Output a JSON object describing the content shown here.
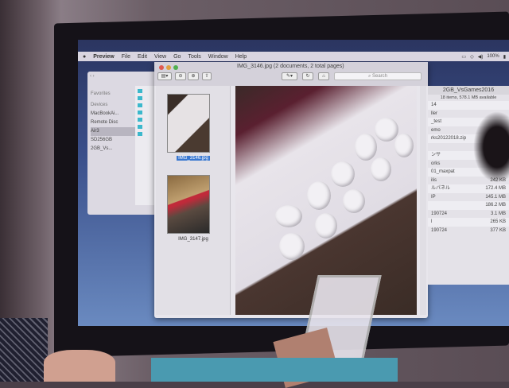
{
  "menubar": {
    "app": "Preview",
    "items": [
      "File",
      "Edit",
      "View",
      "Go",
      "Tools",
      "Window",
      "Help"
    ],
    "battery": "100%"
  },
  "finder_left": {
    "favorites": "Favorites",
    "devices": "Devices",
    "items": [
      "MacBookAi...",
      "Remote Disc",
      "Air3",
      "SD256GB",
      "2GB_Vs..."
    ]
  },
  "preview": {
    "title": "IMG_3146.jpg (2 documents, 2 total pages)",
    "search_placeholder": "Search",
    "thumbnails": [
      {
        "label": "IMG_3146.jpg",
        "selected": true
      },
      {
        "label": "IMG_3147.jpg",
        "selected": false
      }
    ]
  },
  "finder_right": {
    "title": "2GB_VsGames2016",
    "status": "18 items, 578.1 MB available",
    "rows": [
      {
        "name": "14",
        "size": ""
      },
      {
        "name": "ller",
        "size": ""
      },
      {
        "name": "_test",
        "size": ""
      },
      {
        "name": "emo",
        "size": ""
      },
      {
        "name": "rks20122018.zip",
        "size": ""
      },
      {
        "name": "",
        "size": ""
      },
      {
        "name": "ンサ",
        "size": ""
      },
      {
        "name": "orks",
        "size": ""
      },
      {
        "name": "01_maxpat",
        "size": ""
      },
      {
        "name": "ilis",
        "size": "242 KB"
      },
      {
        "name": "ルパネル",
        "size": "172.4 MB"
      },
      {
        "name": "IP",
        "size": "145.1 MB"
      },
      {
        "name": "",
        "size": "186.2 MB"
      },
      {
        "name": "190724",
        "size": "3.1 MB"
      },
      {
        "name": "l",
        "size": "265 KB"
      },
      {
        "name": "190724",
        "size": "377 KB"
      }
    ]
  }
}
